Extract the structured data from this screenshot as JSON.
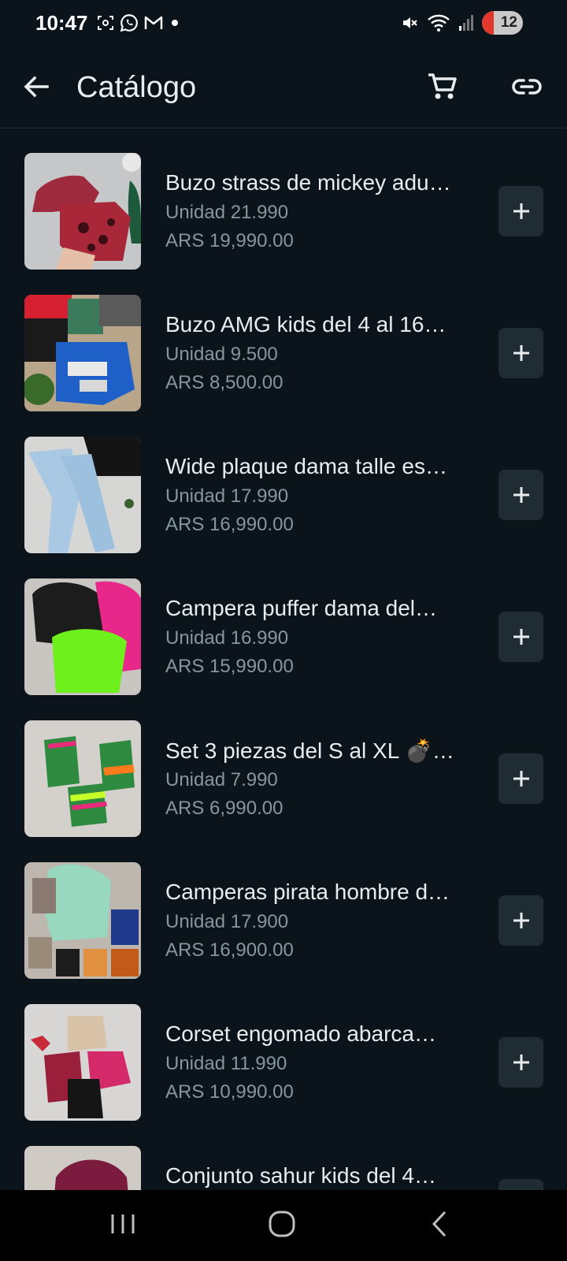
{
  "status_bar": {
    "time": "10:47",
    "battery_level": "12",
    "left_icons": [
      "screenshot-icon",
      "whatsapp-icon",
      "gmail-icon",
      "dot-icon"
    ],
    "right_icons": [
      "mute-icon",
      "wifi-icon",
      "signal-icon",
      "battery-icon"
    ]
  },
  "app_bar": {
    "title": "Catálogo",
    "back_icon": "arrow-left-icon",
    "cart_icon": "shopping-cart-icon",
    "link_icon": "link-icon"
  },
  "items": [
    {
      "name": "Buzo strass de mickey adu…",
      "unit": "Unidad 21.990",
      "price": "ARS 19,990.00"
    },
    {
      "name": "Buzo AMG kids del 4 al 16…",
      "unit": "Unidad 9.500",
      "price": "ARS 8,500.00"
    },
    {
      "name": "Wide plaque dama talle es…",
      "unit": "Unidad 17.990",
      "price": "ARS 16,990.00"
    },
    {
      "name": "Campera puffer dama del…",
      "unit": "Unidad 16.990",
      "price": "ARS 15,990.00"
    },
    {
      "name": "Set 3 piezas del S al XL 💣…",
      "unit": "Unidad 7.990",
      "price": "ARS 6,990.00"
    },
    {
      "name": "Camperas pirata hombre d…",
      "unit": "Unidad 17.900",
      "price": "ARS 16,900.00"
    },
    {
      "name": "Corset engomado abarca…",
      "unit": "Unidad 11.990",
      "price": "ARS 10,990.00"
    },
    {
      "name": "Conjunto sahur kids del 4…",
      "unit": "",
      "price": ""
    }
  ],
  "colors": {
    "background": "#0b141a",
    "text_primary": "#e9edef",
    "text_secondary": "#8696a0",
    "button_bg": "#202c33"
  }
}
